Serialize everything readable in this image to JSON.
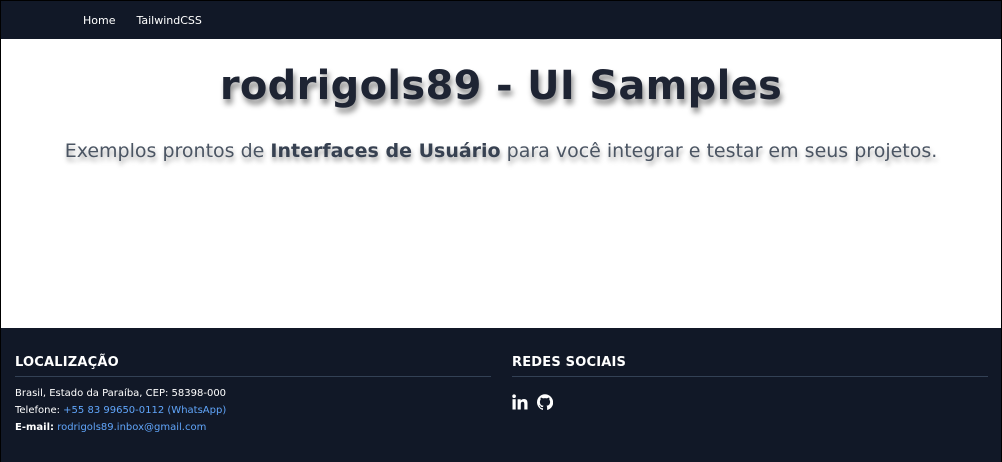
{
  "nav": {
    "home": "Home",
    "tailwind": "TailwindCSS"
  },
  "hero": {
    "title": "rodrigols89 - UI Samples",
    "subtitle_before": "Exemplos prontos de ",
    "subtitle_bold": "Interfaces de Usuário",
    "subtitle_after": " para você integrar e testar em seus projetos."
  },
  "footer": {
    "location": {
      "title": "LOCALIZAÇÃO",
      "address": "Brasil, Estado da Paraíba, CEP: 58398-000",
      "phone_label": "Telefone: ",
      "phone_value": "+55 83 99650-0112 (WhatsApp)",
      "email_label": "E-mail:",
      "email_value": "rodrigols89.inbox@gmail.com"
    },
    "social": {
      "title": "REDES SOCIAIS",
      "icons": [
        "linkedin-icon",
        "github-icon"
      ]
    }
  },
  "colors": {
    "nav_bg": "#111827",
    "footer_bg": "#111827",
    "link": "#60a5fa",
    "title": "#1e2433"
  }
}
